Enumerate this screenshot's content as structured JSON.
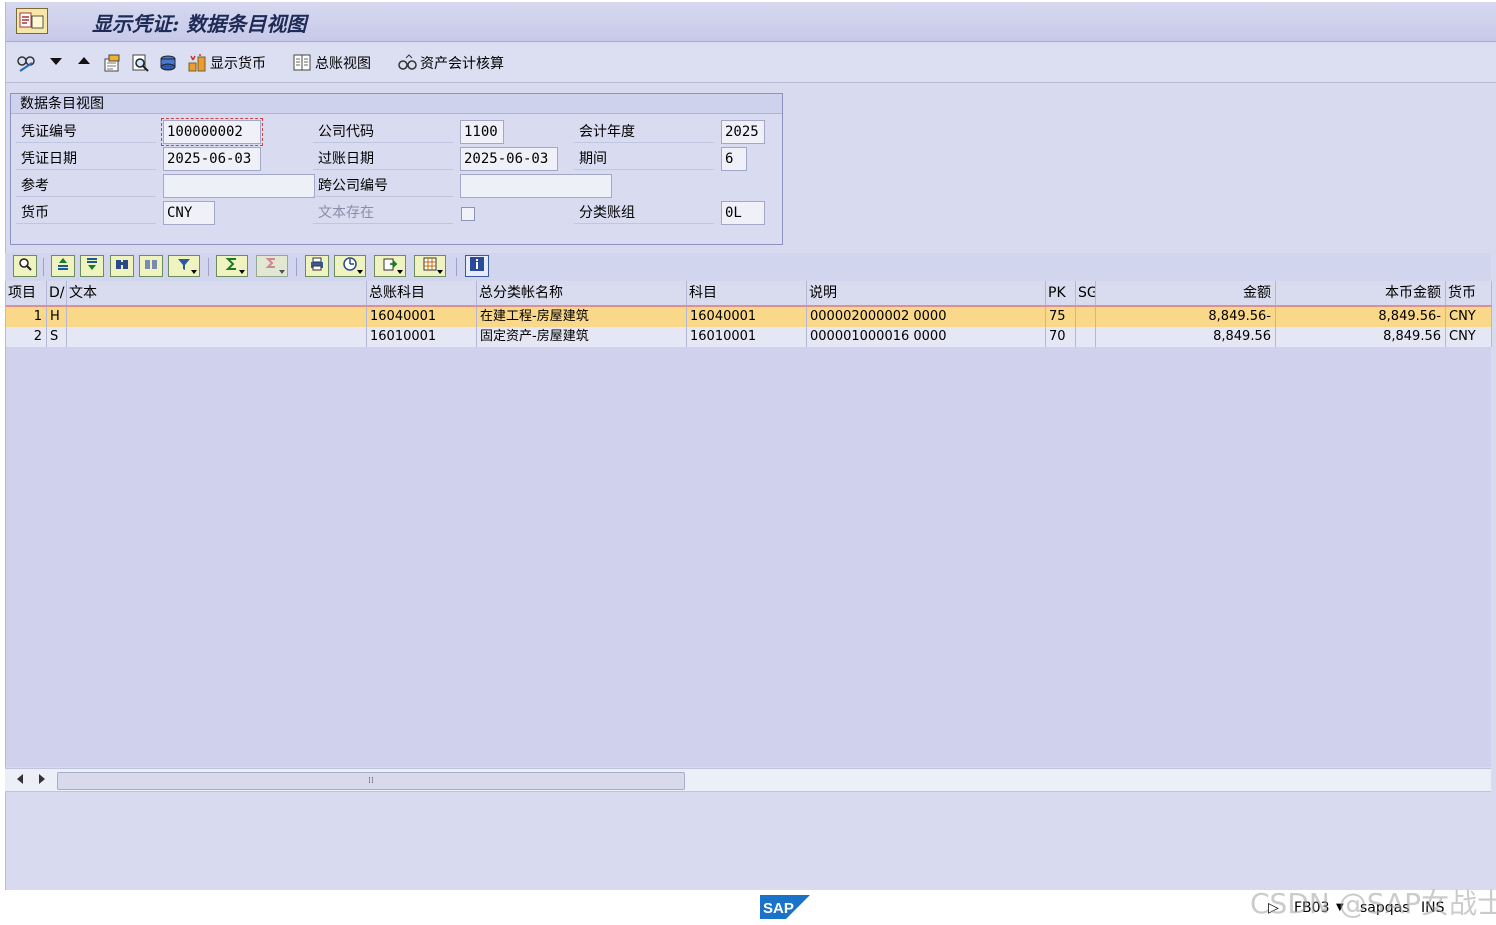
{
  "window": {
    "title": "显示凭证: 数据条目视图"
  },
  "toolbar": {
    "display_currency": "显示货币",
    "gl_view": "总账视图",
    "asset_accounting": "资产会计核算"
  },
  "header": {
    "section_title": "数据条目视图",
    "doc_number": {
      "label": "凭证编号",
      "value": "100000002"
    },
    "company_code": {
      "label": "公司代码",
      "value": "1100"
    },
    "fiscal_year": {
      "label": "会计年度",
      "value": "2025"
    },
    "doc_date": {
      "label": "凭证日期",
      "value": "2025-06-03"
    },
    "posting_date": {
      "label": "过账日期",
      "value": "2025-06-03"
    },
    "period": {
      "label": "期间",
      "value": "6"
    },
    "reference": {
      "label": "参考",
      "value": ""
    },
    "cross_company": {
      "label": "跨公司编号",
      "value": ""
    },
    "currency": {
      "label": "货币",
      "value": "CNY"
    },
    "text_exists": {
      "label": "文本存在",
      "checked": false
    },
    "ledger_group": {
      "label": "分类账组",
      "value": "0L"
    }
  },
  "grid": {
    "columns": [
      "项目",
      "D/",
      "文本",
      "总账科目",
      "总分类帐名称",
      "科目",
      "说明",
      "PK",
      "SG",
      "金额",
      "本币金额",
      "货币"
    ],
    "rows": [
      {
        "item": "1",
        "dc": "H",
        "text": "",
        "gl_account": "16040001",
        "gl_name": "在建工程-房屋建筑",
        "account": "16040001",
        "description": "000002000002 0000",
        "pk": "75",
        "sg": "",
        "amount": "8,849.56-",
        "local_amount": "8,849.56-",
        "currency": "CNY",
        "selected": true
      },
      {
        "item": "2",
        "dc": "S",
        "text": "",
        "gl_account": "16010001",
        "gl_name": "固定资产-房屋建筑",
        "account": "16010001",
        "description": "000001000016 0000",
        "pk": "70",
        "sg": "",
        "amount": "8,849.56",
        "local_amount": "8,849.56",
        "currency": "CNY",
        "selected": false
      }
    ]
  },
  "statusbar": {
    "transaction": "FB03",
    "system": "sapqas",
    "mode": "INS",
    "brand": "SAP"
  },
  "watermark": "CSDN @SAP女战士"
}
